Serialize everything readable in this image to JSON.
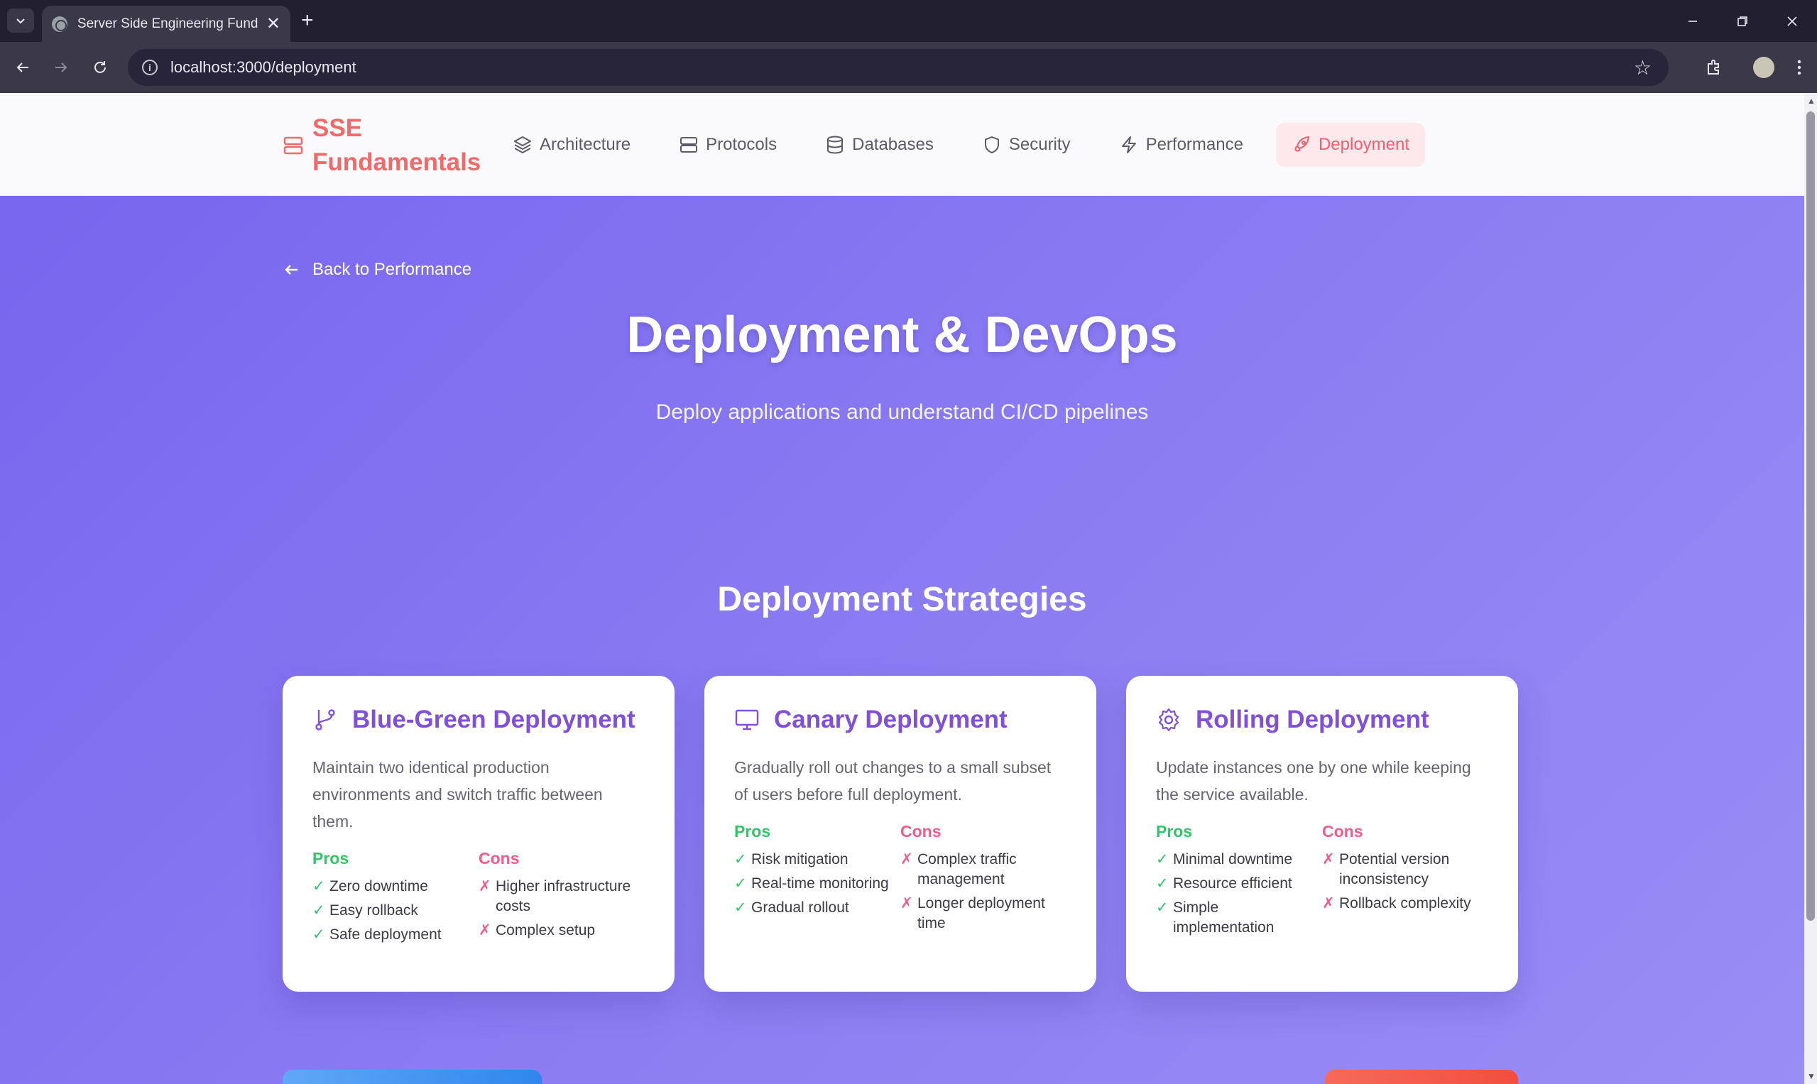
{
  "browser": {
    "tab_title": "Server Side Engineering Fundar",
    "url": "localhost:3000/deployment",
    "tab_close": "✕",
    "new_tab": "+"
  },
  "header": {
    "brand_line1": "SSE",
    "brand_line2": "Fundamentals",
    "nav": [
      {
        "label": "Architecture",
        "icon": "layers-icon"
      },
      {
        "label": "Protocols",
        "icon": "server-icon"
      },
      {
        "label": "Databases",
        "icon": "database-icon"
      },
      {
        "label": "Security",
        "icon": "shield-icon"
      },
      {
        "label": "Performance",
        "icon": "zap-icon"
      },
      {
        "label": "Deployment",
        "icon": "rocket-icon",
        "active": true
      }
    ]
  },
  "hero": {
    "back_label": "Back to Performance",
    "title": "Deployment & DevOps",
    "subtitle": "Deploy applications and understand CI/CD pipelines"
  },
  "strategies": {
    "title": "Deployment Strategies",
    "pros_label": "Pros",
    "cons_label": "Cons",
    "cards": [
      {
        "title": "Blue-Green Deployment",
        "icon": "git-branch-icon",
        "desc": "Maintain two identical production environments and switch traffic between them.",
        "pros": [
          "Zero downtime",
          "Easy rollback",
          "Safe deployment"
        ],
        "cons": [
          "Higher infrastructure costs",
          "Complex setup"
        ]
      },
      {
        "title": "Canary Deployment",
        "icon": "monitor-icon",
        "desc": "Gradually roll out changes to a small subset of users before full deployment.",
        "pros": [
          "Risk mitigation",
          "Real-time monitoring",
          "Gradual rollout"
        ],
        "cons": [
          "Complex traffic management",
          "Longer deployment time"
        ]
      },
      {
        "title": "Rolling Deployment",
        "icon": "settings-icon",
        "desc": "Update instances one by one while keeping the service available.",
        "pros": [
          "Minimal downtime",
          "Resource efficient",
          "Simple implementation"
        ],
        "cons": [
          "Potential version inconsistency",
          "Rollback complexity"
        ]
      }
    ]
  },
  "colors": {
    "brand": "#f06a6a",
    "accent": "#8050db",
    "pros": "#34c46a",
    "cons": "#f25c8a",
    "bg_start": "#7664ee",
    "bg_end": "#9a8df5"
  }
}
